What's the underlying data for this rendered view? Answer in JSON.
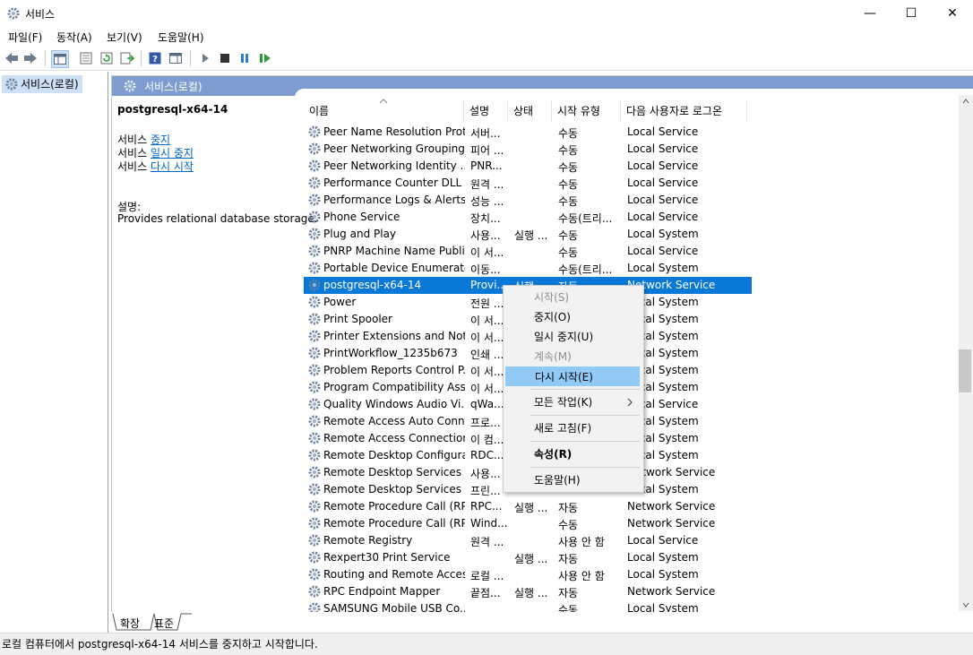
{
  "window": {
    "title": "서비스",
    "buttons": [
      "—",
      "☐",
      "✕"
    ]
  },
  "menu": [
    "파일(F)",
    "동작(A)",
    "보기(V)",
    "도움말(H)"
  ],
  "tree": {
    "root": "서비스(로컬)"
  },
  "pane": {
    "header": "서비스(로컬)"
  },
  "details": {
    "service_name": "postgresql-x64-14",
    "actions": [
      {
        "prefix": "서비스 ",
        "link": "중지"
      },
      {
        "prefix": "서비스 ",
        "link": "일시 중지"
      },
      {
        "prefix": "서비스 ",
        "link": "다시 시작"
      }
    ],
    "desc_label": "설명:",
    "desc_text": "Provides relational database storage."
  },
  "columns": [
    "이름",
    "설명",
    "상태",
    "시작 유형",
    "다음 사용자로 로그온"
  ],
  "rows": [
    {
      "name": "Peer Name Resolution Prot...",
      "desc": "서버...",
      "status": "",
      "start": "수동",
      "logon": "Local Service"
    },
    {
      "name": "Peer Networking Grouping",
      "desc": "피어 ...",
      "status": "",
      "start": "수동",
      "logon": "Local Service"
    },
    {
      "name": "Peer Networking Identity ...",
      "desc": "PNR...",
      "status": "",
      "start": "수동",
      "logon": "Local Service"
    },
    {
      "name": "Performance Counter DLL ...",
      "desc": "원격 ...",
      "status": "",
      "start": "수동",
      "logon": "Local Service"
    },
    {
      "name": "Performance Logs & Alerts",
      "desc": "성능 ...",
      "status": "",
      "start": "수동",
      "logon": "Local Service"
    },
    {
      "name": "Phone Service",
      "desc": "장치...",
      "status": "",
      "start": "수동(트리...",
      "logon": "Local Service"
    },
    {
      "name": "Plug and Play",
      "desc": "사용...",
      "status": "실행 ...",
      "start": "수동",
      "logon": "Local System"
    },
    {
      "name": "PNRP Machine Name Publi...",
      "desc": "이 서...",
      "status": "",
      "start": "수동",
      "logon": "Local Service"
    },
    {
      "name": "Portable Device Enumerato...",
      "desc": "이동...",
      "status": "",
      "start": "수동(트리...",
      "logon": "Local System"
    },
    {
      "name": "postgresql-x64-14",
      "desc": "Provi...",
      "status": "실행 ...",
      "start": "자동",
      "logon": "Network Service",
      "selected": true
    },
    {
      "name": "Power",
      "desc": "전원 ...",
      "status": "",
      "start": "",
      "logon": "Local System"
    },
    {
      "name": "Print Spooler",
      "desc": "이 서...",
      "status": "",
      "start": "",
      "logon": "Local System"
    },
    {
      "name": "Printer Extensions and Noti...",
      "desc": "이 서...",
      "status": "",
      "start": "",
      "logon": "Local System"
    },
    {
      "name": "PrintWorkflow_1235b673",
      "desc": "인쇄 ...",
      "status": "",
      "start": "",
      "logon": "Local System"
    },
    {
      "name": "Problem Reports Control P...",
      "desc": "이 서...",
      "status": "",
      "start": "",
      "logon": "Local System"
    },
    {
      "name": "Program Compatibility Assi...",
      "desc": "이 서...",
      "status": "",
      "start": "",
      "logon": "Local System"
    },
    {
      "name": "Quality Windows Audio Vi...",
      "desc": "qWa...",
      "status": "",
      "start": "",
      "logon": "Local Service"
    },
    {
      "name": "Remote Access Auto Conn...",
      "desc": "프로...",
      "status": "",
      "start": "",
      "logon": "Local System"
    },
    {
      "name": "Remote Access Connection...",
      "desc": "이 컴...",
      "status": "",
      "start": "",
      "logon": "Local System"
    },
    {
      "name": "Remote Desktop Configura...",
      "desc": "RDC...",
      "status": "",
      "start": "",
      "logon": "Local System"
    },
    {
      "name": "Remote Desktop Services",
      "desc": "사용...",
      "status": "",
      "start": "",
      "logon": "Network Service"
    },
    {
      "name": "Remote Desktop Services ...",
      "desc": "프린...",
      "status": "",
      "start": "",
      "logon": "Local System"
    },
    {
      "name": "Remote Procedure Call (RP...",
      "desc": "RPC...",
      "status": "실행 ...",
      "start": "자동",
      "logon": "Network Service"
    },
    {
      "name": "Remote Procedure Call (RP...",
      "desc": "Wind...",
      "status": "",
      "start": "수동",
      "logon": "Network Service"
    },
    {
      "name": "Remote Registry",
      "desc": "원격 ...",
      "status": "",
      "start": "사용 안 함",
      "logon": "Local Service"
    },
    {
      "name": "Rexpert30 Print Service",
      "desc": "",
      "status": "실행 ...",
      "start": "자동",
      "logon": "Local System"
    },
    {
      "name": "Routing and Remote Access",
      "desc": "로컬 ...",
      "status": "",
      "start": "사용 안 함",
      "logon": "Local System"
    },
    {
      "name": "RPC Endpoint Mapper",
      "desc": "끝점...",
      "status": "실행 ...",
      "start": "자동",
      "logon": "Network Service"
    },
    {
      "name": "SAMSUNG Mobile USB Co...",
      "desc": "",
      "status": "",
      "start": "수동",
      "logon": "Local System"
    }
  ],
  "context_menu": [
    {
      "label": "시작(S)",
      "disabled": true
    },
    {
      "label": "중지(O)"
    },
    {
      "label": "일시 중지(U)"
    },
    {
      "label": "계속(M)",
      "disabled": true
    },
    {
      "label": "다시 시작(E)",
      "highlight": true
    },
    {
      "sep": true
    },
    {
      "label": "모든 작업(K)",
      "submenu": true
    },
    {
      "sep": true
    },
    {
      "label": "새로 고침(F)"
    },
    {
      "sep": true
    },
    {
      "label": "속성(R)",
      "bold": true
    },
    {
      "sep": true
    },
    {
      "label": "도움말(H)"
    }
  ],
  "tabs": [
    "확장",
    "표준"
  ],
  "status_text": "로컬 컴퓨터에서 postgresql-x64-14 서비스를 중지하고 시작합니다.",
  "colors": {
    "selection": "#0a78d7",
    "header": "#7e9ccf",
    "menu_highlight": "#91c9f7"
  }
}
